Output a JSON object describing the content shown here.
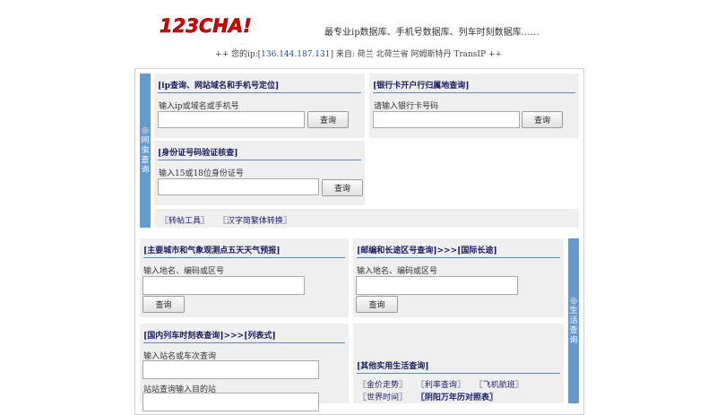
{
  "header": {
    "logo_text": "123CHA!",
    "slogan": "最专业ip数据库、手机号数据库、列车时刻数据库……",
    "ip_prefix": "++ 您的ip:[",
    "ip": "136.144.187.131",
    "ip_suffix": "] 来自: 荷兰 北荷兰省 阿姆斯特丹 TransIP ++"
  },
  "sections": {
    "web": {
      "label": "◎网虫查询"
    },
    "life": {
      "label": "◎生活查询"
    }
  },
  "ip_query": {
    "title": "[ip查询、网站域名和手机号定位]",
    "label": "输入ip或域名或手机号",
    "button": "查询"
  },
  "bank_query": {
    "title": "[银行卡开户行归属地查询]",
    "label": "请输入银行卡号码",
    "button": "查询"
  },
  "id_query": {
    "title": "[身份证号码验证核查]",
    "label": "输入15或18位身份证号",
    "button": "查询"
  },
  "tools": {
    "items": [
      "〖转帖工具〗",
      "〖汉字简繁体转换〗"
    ]
  },
  "weather": {
    "title": "[主要城市和气象观测点五天天气预报]",
    "label": "输入地名、编码或区号",
    "button": "查询"
  },
  "postal": {
    "title": "[邮编和长途区号查询]>>>[国际长途]",
    "label": "输入地名、编码或区号",
    "button": "查询"
  },
  "train": {
    "title": "[国内列车时刻表查询]>>>[列表式]",
    "label1": "输入站名或车次查询",
    "label2": "站站查询输入目的站"
  },
  "other": {
    "title": "[其他实用生活查询]",
    "links_row1": [
      "〖金价走势〗",
      "〖利率查询〗",
      "〖飞机航班〗"
    ],
    "links_row2": [
      "〖世界时间〗",
      "〖阴阳万年历对照表〗"
    ]
  },
  "colors": {
    "accent_bar": "#6699cc",
    "panel_bg": "#efefef",
    "title_text": "#1a1a5e",
    "logo_red": "#d40000"
  }
}
